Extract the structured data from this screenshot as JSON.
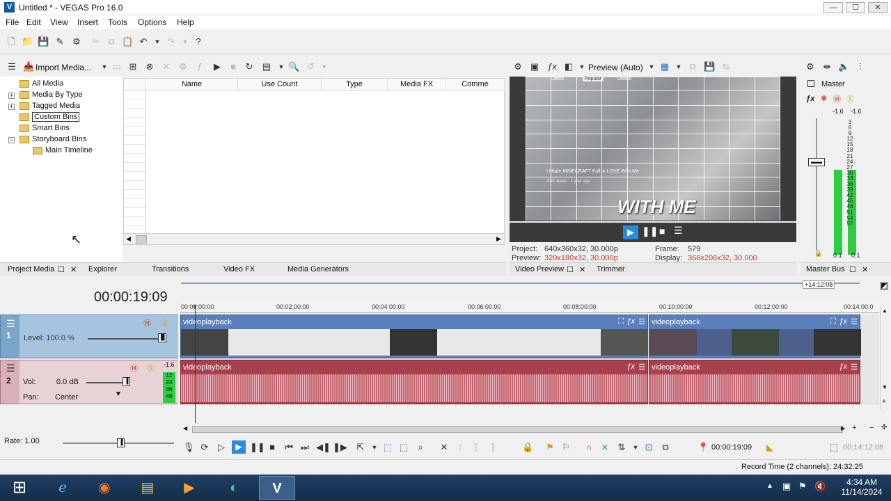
{
  "window": {
    "title": "Untitled * - VEGAS Pro 16.0",
    "min": "—",
    "max": "☐",
    "close": "✕"
  },
  "menu": [
    "File",
    "Edit",
    "View",
    "Insert",
    "Tools",
    "Options",
    "Help"
  ],
  "project_media": {
    "import_label": "Import Media...",
    "tree": [
      "All Media",
      "Media By Type",
      "Tagged Media",
      "Custom Bins",
      "Smart Bins",
      "Storyboard Bins",
      "Main Timeline"
    ],
    "columns": [
      "Name",
      "Use Count",
      "Type",
      "Media FX",
      "Comme"
    ],
    "tabs": [
      "Project Media",
      "Explorer",
      "Transitions",
      "Video FX",
      "Media Generators"
    ]
  },
  "preview": {
    "mode": "Preview (Auto)",
    "overlay_labels": [
      "Latest",
      "Popular",
      "Oldest"
    ],
    "overlay_title": "I Made MINECRAFT Fall in LOVE With Me",
    "overlay_meta": "4.8K views · 1 year ago",
    "caption": "WITH ME",
    "info": {
      "project_label": "Project:",
      "project_value": "640x360x32, 30.000p",
      "preview_label": "Preview:",
      "preview_value": "320x180x32, 30.000p",
      "frame_label": "Frame:",
      "frame_value": "579",
      "display_label": "Display:",
      "display_value": "366x206x32, 30.000"
    },
    "tabs": [
      "Video Preview",
      "Trimmer"
    ]
  },
  "master": {
    "title": "Master",
    "peak_left": "-1.6",
    "peak_right": "-1.6",
    "scale": [
      "3",
      "6",
      "9",
      "12",
      "15",
      "18",
      "21",
      "24",
      "27",
      "30",
      "33",
      "36",
      "39",
      "42",
      "45",
      "48",
      "51",
      "54",
      "57"
    ],
    "bottom_left": "0.1",
    "bottom_right": "0.1",
    "tab": "Master Bus"
  },
  "timeline": {
    "timecode": "00:00:19:09",
    "loop_end": "+14:12:08",
    "ruler": [
      "00:00:00:00",
      "00:02:00:00",
      "00:04:00:00",
      "00:06:00:00",
      "00:08:00:00",
      "00:10:00:00",
      "00:12:00:00",
      "00:14:00:0"
    ],
    "video_track": {
      "number": "1",
      "level": "Level: 100.0 %"
    },
    "audio_track": {
      "number": "2",
      "vol_label": "Vol:",
      "vol_value": "0.0 dB",
      "pan_label": "Pan:",
      "pan_value": "Center",
      "peak": "-1.6",
      "meter_scale": [
        "12",
        "24",
        "36",
        "48"
      ]
    },
    "clips": [
      "videoplayback",
      "videoplayback",
      "videoplayback",
      "videoplayback"
    ],
    "rate": "Rate: 1.00",
    "transport_time": "00:00:19:09",
    "transport_end": "00:14:12:08",
    "record_time": "Record Time (2 channels): 24:32:25"
  },
  "taskbar": {
    "time": "4:34 AM",
    "date": "11/14/2024"
  }
}
